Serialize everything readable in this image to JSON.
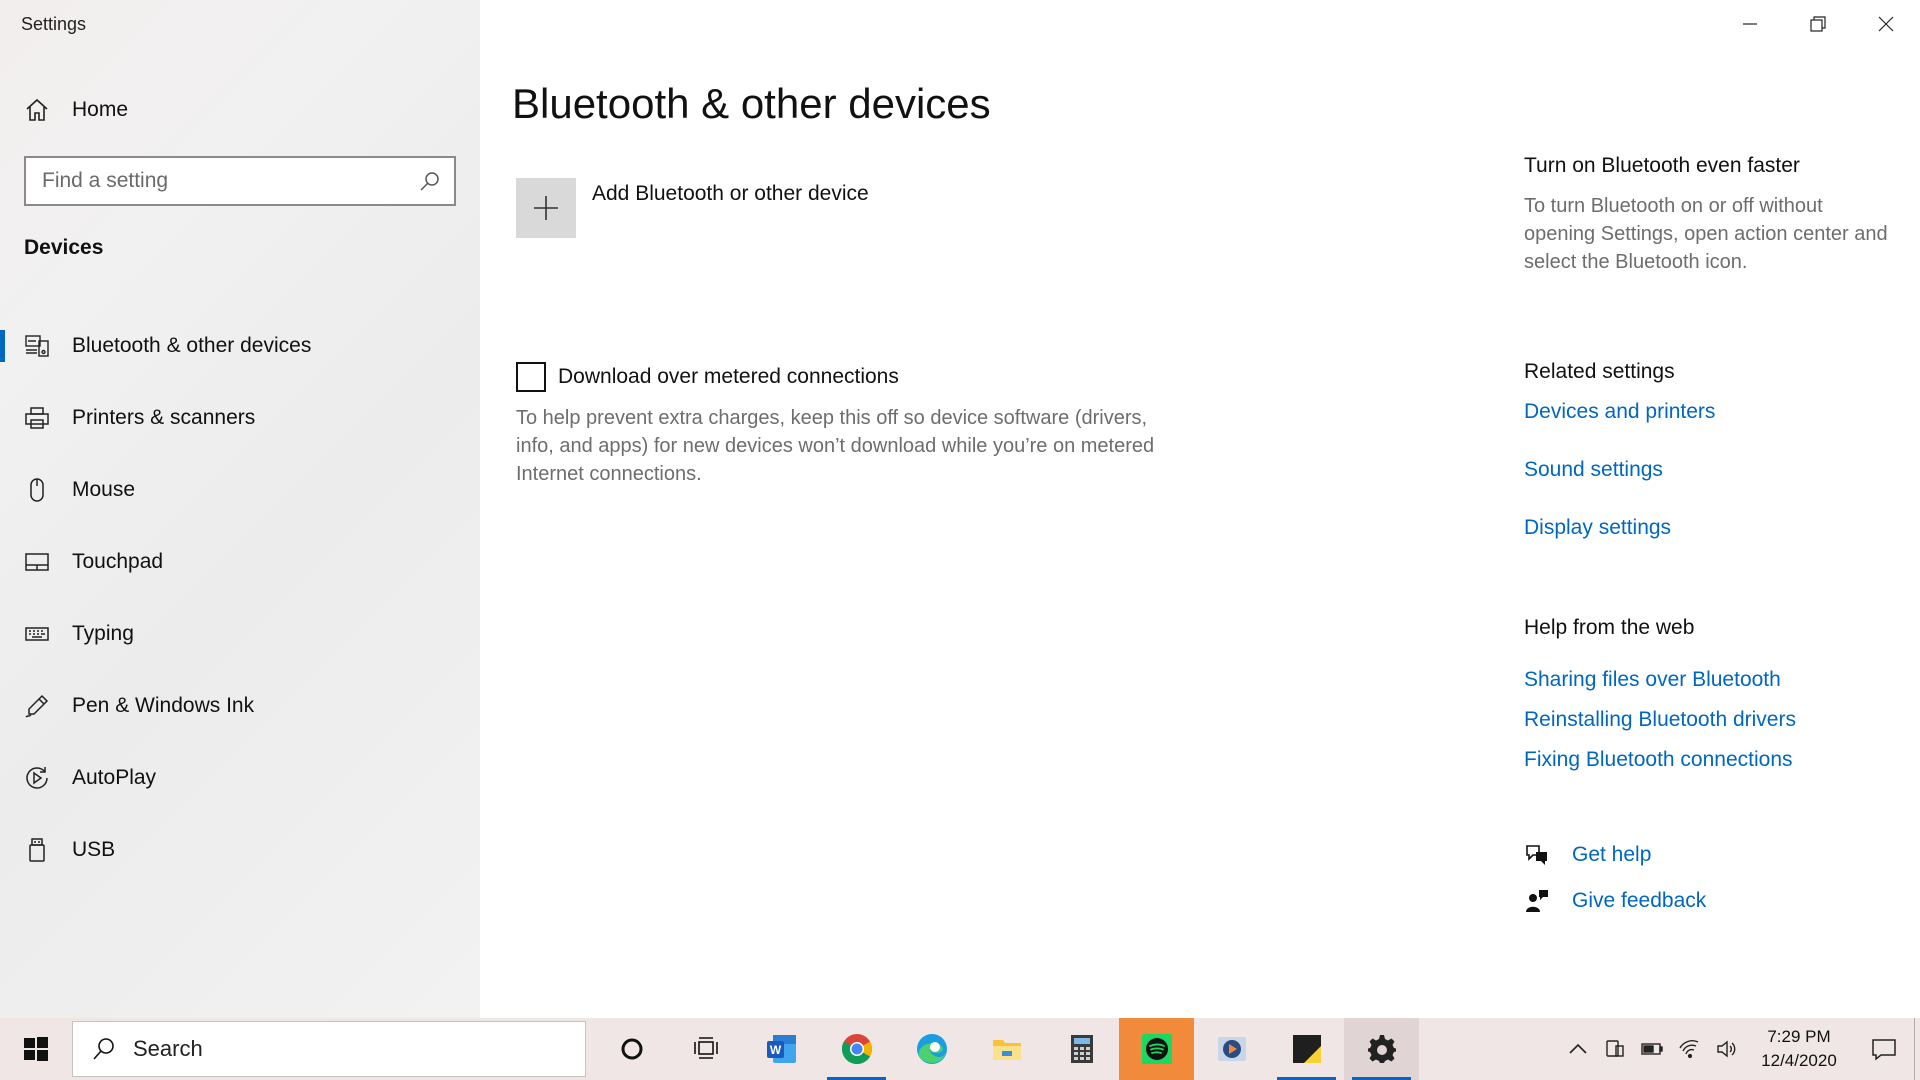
{
  "window": {
    "title": "Settings"
  },
  "sidebar": {
    "home_label": "Home",
    "search_placeholder": "Find a setting",
    "section_label": "Devices",
    "items": [
      {
        "label": "Bluetooth & other devices",
        "icon": "bluetooth-devices-icon",
        "active": true
      },
      {
        "label": "Printers & scanners",
        "icon": "printer-icon"
      },
      {
        "label": "Mouse",
        "icon": "mouse-icon"
      },
      {
        "label": "Touchpad",
        "icon": "touchpad-icon"
      },
      {
        "label": "Typing",
        "icon": "keyboard-icon"
      },
      {
        "label": "Pen & Windows Ink",
        "icon": "pen-icon"
      },
      {
        "label": "AutoPlay",
        "icon": "autoplay-icon"
      },
      {
        "label": "USB",
        "icon": "usb-icon"
      }
    ]
  },
  "main": {
    "title": "Bluetooth & other devices",
    "add_device_label": "Add Bluetooth or other device",
    "metered": {
      "label": "Download over metered connections",
      "checked": false,
      "description": "To help prevent extra charges, keep this off so device software (drivers, info, and apps) for new devices won’t download while you’re on metered Internet connections."
    }
  },
  "right_panel": {
    "faster": {
      "heading": "Turn on Bluetooth even faster",
      "description": "To turn Bluetooth on or off without opening Settings, open action center and select the Bluetooth icon."
    },
    "related": {
      "heading": "Related settings",
      "links": [
        "Devices and printers",
        "Sound settings",
        "Display settings"
      ]
    },
    "help_web": {
      "heading": "Help from the web",
      "links": [
        "Sharing files over Bluetooth",
        "Reinstalling Bluetooth drivers",
        "Fixing Bluetooth connections"
      ]
    },
    "get_help": "Get help",
    "give_feedback": "Give feedback"
  },
  "taskbar": {
    "search_placeholder": "Search",
    "apps": [
      "cortana-icon",
      "task-view-icon",
      "word-icon",
      "chrome-icon",
      "edge-icon",
      "file-explorer-icon",
      "calculator-icon",
      "spotify-icon",
      "media-player-icon",
      "sticky-notes-icon",
      "settings-icon"
    ],
    "clock_time": "7:29 PM",
    "clock_date": "12/4/2020"
  },
  "colors": {
    "accent": "#0067c0",
    "link": "#0067c0",
    "sidebar_bg": "#f1f1f1",
    "taskbar_bg": "#f0e6e6",
    "spotify_highlight": "#f28a3c"
  }
}
